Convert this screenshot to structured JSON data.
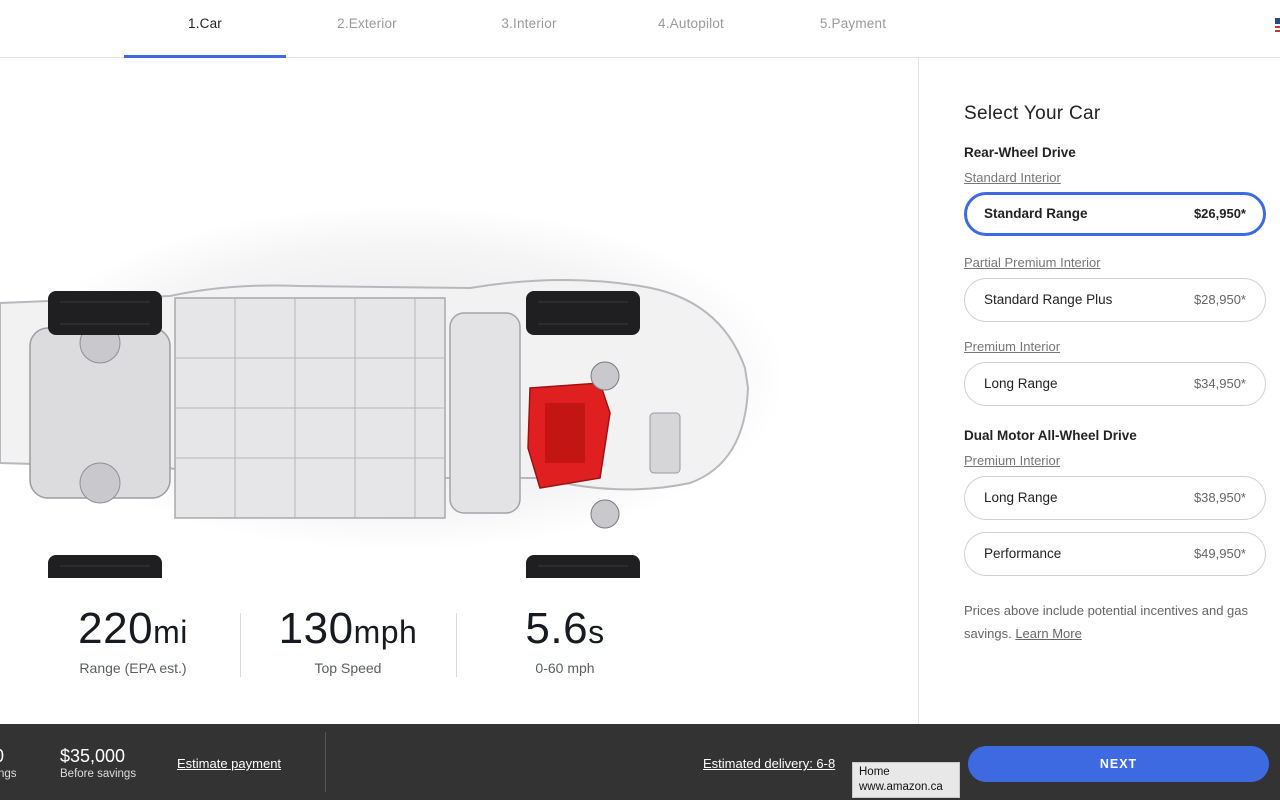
{
  "steps": [
    {
      "label": "1.Car",
      "active": true
    },
    {
      "label": "2.Exterior",
      "active": false
    },
    {
      "label": "3.Interior",
      "active": false
    },
    {
      "label": "4.Autopilot",
      "active": false
    },
    {
      "label": "5.Payment",
      "active": false
    }
  ],
  "stats": [
    {
      "value": "220",
      "unit": "mi",
      "label": "Range (EPA est.)"
    },
    {
      "value": "130",
      "unit": "mph",
      "label": "Top Speed"
    },
    {
      "value": "5.6",
      "unit": "s",
      "label": "0-60 mph"
    }
  ],
  "panel": {
    "title": "Select Your Car",
    "rwd_title": "Rear-Wheel Drive",
    "awd_title": "Dual Motor All-Wheel Drive",
    "standard_interior": "Standard Interior",
    "partial_premium_interior": "Partial Premium Interior",
    "premium_interior_rwd": "Premium Interior",
    "premium_interior_awd": "Premium Interior",
    "options": [
      {
        "name": "Standard Range",
        "price": "$26,950*",
        "selected": true
      },
      {
        "name": "Standard Range Plus",
        "price": "$28,950*",
        "selected": false
      },
      {
        "name": "Long Range",
        "price": "$34,950*",
        "selected": false
      },
      {
        "name": "Long Range",
        "price": "$38,950*",
        "selected": false
      },
      {
        "name": "Performance",
        "price": "$49,950*",
        "selected": false
      }
    ],
    "note_text": "Prices above include potential incentives and gas savings.",
    "learn_more": "Learn More"
  },
  "bottom": {
    "cut_value": "0",
    "cut_label": "ngs",
    "price": "$35,000",
    "price_label": "Before savings",
    "estimate_link": "Estimate payment",
    "delivery": "Estimated delivery: 6-8",
    "next": "NEXT"
  },
  "tooltip": {
    "line1": "Home",
    "line2": "www.amazon.ca"
  },
  "colors": {
    "accent": "#3e6ae1",
    "bottom_bar": "#333333",
    "motor": "#e02020"
  }
}
